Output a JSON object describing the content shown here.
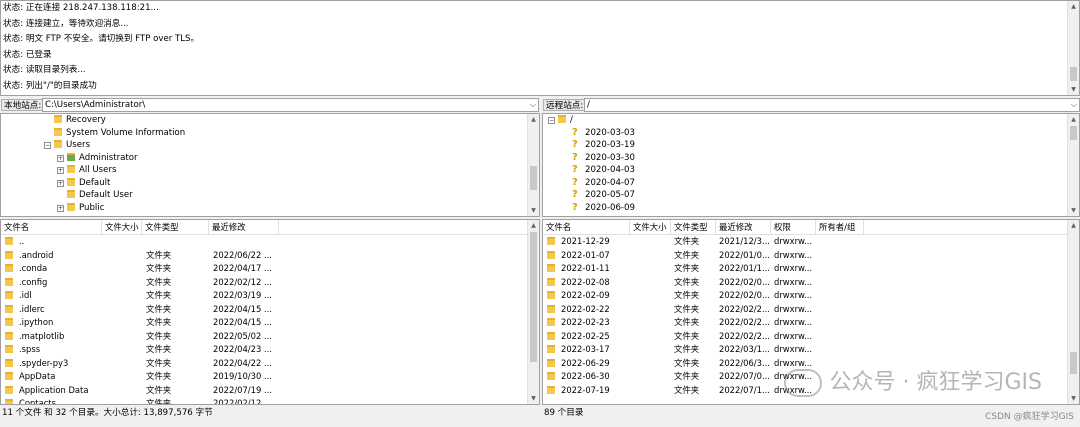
{
  "log": {
    "lines": [
      "状态:  正在连接 218.247.138.118:21...",
      "状态:  连接建立，等待欢迎消息...",
      "状态:  明文 FTP 不安全。请切换到 FTP over TLS。",
      "状态:  已登录",
      "状态:  读取目录列表...",
      "状态:  列出\"/\"的目录成功"
    ]
  },
  "local": {
    "site_label": "本地站点:",
    "path": "C:\\Users\\Administrator\\",
    "tree": [
      {
        "label": "Recovery",
        "level": 2,
        "expander": ""
      },
      {
        "label": "System Volume Information",
        "level": 2,
        "expander": ""
      },
      {
        "label": "Users",
        "level": 2,
        "expander": "−"
      },
      {
        "label": "Administrator",
        "level": 3,
        "expander": "+",
        "icon": "user-folder"
      },
      {
        "label": "All Users",
        "level": 3,
        "expander": "+"
      },
      {
        "label": "Default",
        "level": 3,
        "expander": "+"
      },
      {
        "label": "Default User",
        "level": 3,
        "expander": ""
      },
      {
        "label": "Public",
        "level": 3,
        "expander": "+"
      }
    ],
    "columns": [
      "文件名",
      "文件大小",
      "文件类型",
      "最近修改"
    ],
    "files": [
      {
        "name": "..",
        "type": "",
        "modified": ""
      },
      {
        "name": ".android",
        "type": "文件夹",
        "modified": "2022/06/22 ..."
      },
      {
        "name": ".conda",
        "type": "文件夹",
        "modified": "2022/04/17 ..."
      },
      {
        "name": ".config",
        "type": "文件夹",
        "modified": "2022/02/12 ..."
      },
      {
        "name": ".idl",
        "type": "文件夹",
        "modified": "2022/03/19 ..."
      },
      {
        "name": ".idlerc",
        "type": "文件夹",
        "modified": "2022/04/15 ..."
      },
      {
        "name": ".ipython",
        "type": "文件夹",
        "modified": "2022/04/15 ..."
      },
      {
        "name": ".matplotlib",
        "type": "文件夹",
        "modified": "2022/05/02 ..."
      },
      {
        "name": ".spss",
        "type": "文件夹",
        "modified": "2022/04/23 ..."
      },
      {
        "name": ".spyder-py3",
        "type": "文件夹",
        "modified": "2022/04/22 ..."
      },
      {
        "name": "AppData",
        "type": "文件夹",
        "modified": "2019/10/30 ..."
      },
      {
        "name": "Application Data",
        "type": "文件夹",
        "modified": "2022/07/19 ..."
      },
      {
        "name": "Contacts",
        "type": "文件夹",
        "modified": "2022/02/12 ..."
      }
    ],
    "status": "11 个文件 和 32 个目录。大小总计: 13,897,576 字节"
  },
  "remote": {
    "site_label": "远程站点:",
    "path": "/",
    "tree_root": "/",
    "tree": [
      "2020-03-03",
      "2020-03-19",
      "2020-03-30",
      "2020-04-03",
      "2020-04-07",
      "2020-05-07",
      "2020-06-09"
    ],
    "columns": [
      "文件名",
      "文件大小",
      "文件类型",
      "最近修改",
      "权限",
      "所有者/组"
    ],
    "files": [
      {
        "name": "2021-12-29",
        "type": "文件夹",
        "modified": "2021/12/3...",
        "perm": "drwxrw..."
      },
      {
        "name": "2022-01-07",
        "type": "文件夹",
        "modified": "2022/01/0...",
        "perm": "drwxrw..."
      },
      {
        "name": "2022-01-11",
        "type": "文件夹",
        "modified": "2022/01/1...",
        "perm": "drwxrw..."
      },
      {
        "name": "2022-02-08",
        "type": "文件夹",
        "modified": "2022/02/0...",
        "perm": "drwxrw..."
      },
      {
        "name": "2022-02-09",
        "type": "文件夹",
        "modified": "2022/02/0...",
        "perm": "drwxrw..."
      },
      {
        "name": "2022-02-22",
        "type": "文件夹",
        "modified": "2022/02/2...",
        "perm": "drwxrw..."
      },
      {
        "name": "2022-02-23",
        "type": "文件夹",
        "modified": "2022/02/2...",
        "perm": "drwxrw..."
      },
      {
        "name": "2022-02-25",
        "type": "文件夹",
        "modified": "2022/02/2...",
        "perm": "drwxrw..."
      },
      {
        "name": "2022-03-17",
        "type": "文件夹",
        "modified": "2022/03/1...",
        "perm": "drwxrw..."
      },
      {
        "name": "2022-06-29",
        "type": "文件夹",
        "modified": "2022/06/3...",
        "perm": "drwxrw..."
      },
      {
        "name": "2022-06-30",
        "type": "文件夹",
        "modified": "2022/07/0...",
        "perm": "drwxrw..."
      },
      {
        "name": "2022-07-19",
        "type": "文件夹",
        "modified": "2022/07/1...",
        "perm": "drwxrw..."
      }
    ],
    "status": "89 个目录"
  },
  "watermark": {
    "text": "公众号 · 疯狂学习GIS",
    "csdn": "CSDN @疯狂学习GIS"
  },
  "colors": {
    "folder": "#f2c94c",
    "selected_border": "#b0b0b0",
    "pane_border": "#a0a0a0"
  }
}
